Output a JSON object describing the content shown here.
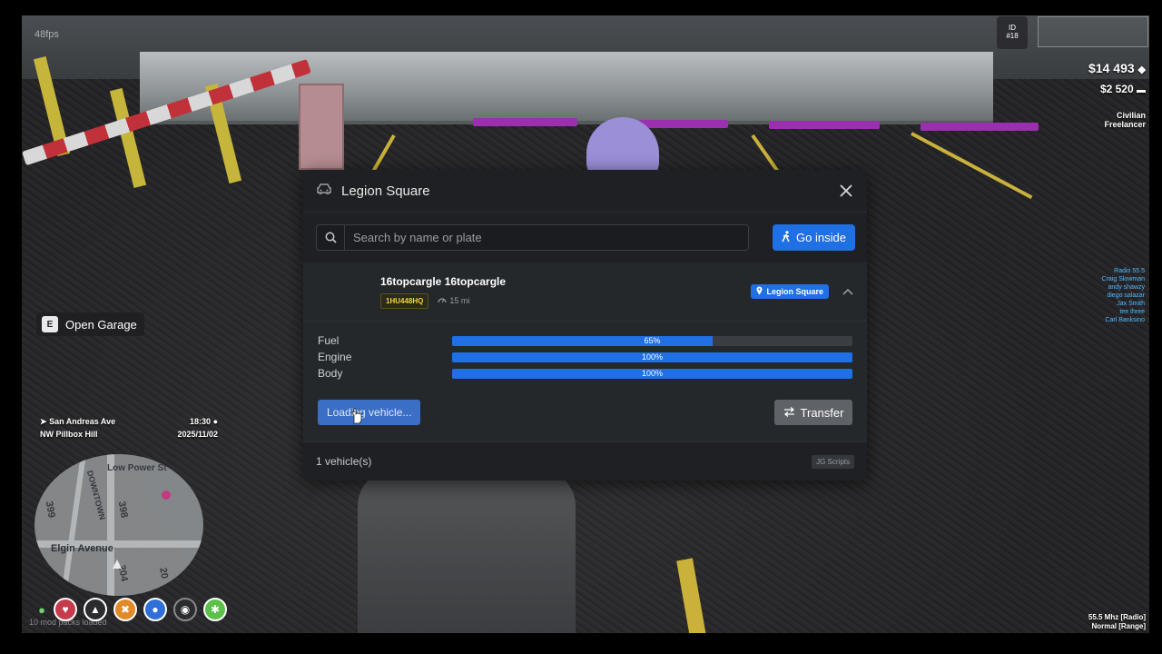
{
  "hud": {
    "fps": "48fps",
    "server_id": "ID\n#18",
    "cash": "$14 493",
    "bank": "$2 520",
    "job_title": "Civilian",
    "job_grade": "Freelancer",
    "open_garage": {
      "key": "E",
      "label": "Open Garage"
    },
    "street": "San Andreas Ave",
    "area": "NW Pillbox Hill",
    "time": "18:30",
    "date": "2025/11/02",
    "minimap_labels": [
      "Low Power St",
      "DOWNTOWN",
      "398",
      "399",
      "Elgin Avenue",
      "204",
      "20"
    ],
    "radio_header": "Radio 55.5",
    "radio_members": [
      "Craig Slowman",
      "andy shawzy",
      "diego salazar",
      "Jax Smith",
      "tee three",
      "Carl Banksino"
    ],
    "mods_loaded": "10 mod packs loaded",
    "frequency": "55.5 Mhz [Radio]",
    "voice_mode": "Normal [Range]"
  },
  "garage": {
    "title": "Legion Square",
    "search_placeholder": "Search by name or plate",
    "go_inside_label": "Go inside",
    "vehicle": {
      "name": "16topcargle 16topcargle",
      "plate": "1HU448HQ",
      "mileage": "15 mi",
      "location": "Legion Square",
      "stats": [
        {
          "label": "Fuel",
          "value": 65,
          "text": "65%"
        },
        {
          "label": "Engine",
          "value": 100,
          "text": "100%"
        },
        {
          "label": "Body",
          "value": 100,
          "text": "100%"
        }
      ],
      "load_label": "Loading vehicle...",
      "transfer_label": "Transfer"
    },
    "count_text": "1 vehicle(s)",
    "credit": "JG Scripts"
  },
  "colors": {
    "accent": "#1f6fe5",
    "panel": "#1e2023",
    "plate_text": "#f3d23a"
  }
}
